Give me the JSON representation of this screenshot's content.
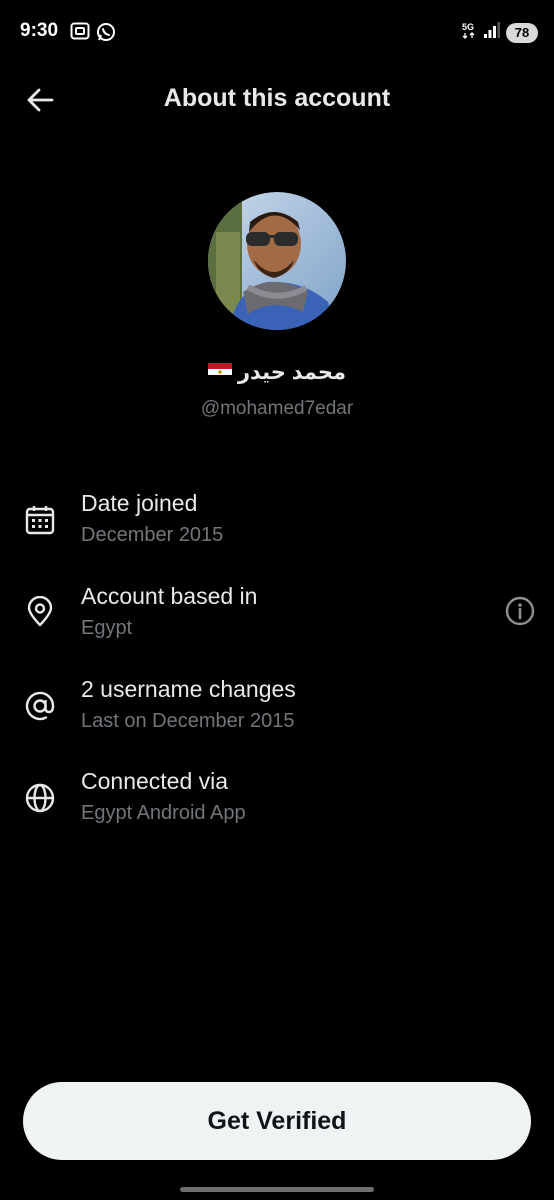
{
  "status_bar": {
    "time": "9:30",
    "battery": "78",
    "network": "5G",
    "left_icons": [
      "screenshot-icon",
      "whatsapp-icon"
    ],
    "right_icons": [
      "5g-icon",
      "signal-icon",
      "battery-icon"
    ]
  },
  "header": {
    "title": "About this account",
    "back_icon": "arrow-left-icon"
  },
  "profile": {
    "display_name": "محمد حيدر",
    "flag": "Egypt flag",
    "handle": "@mohamed7edar"
  },
  "info": [
    {
      "icon": "calendar-icon",
      "title": "Date joined",
      "subtitle": "December 2015"
    },
    {
      "icon": "location-pin-icon",
      "title": "Account based in",
      "subtitle": "Egypt",
      "action_icon": "info-icon"
    },
    {
      "icon": "at-sign-icon",
      "title": "2 username changes",
      "subtitle": "Last on December 2015"
    },
    {
      "icon": "globe-icon",
      "title": "Connected via",
      "subtitle": "Egypt Android App"
    }
  ],
  "cta": {
    "label": "Get Verified"
  }
}
